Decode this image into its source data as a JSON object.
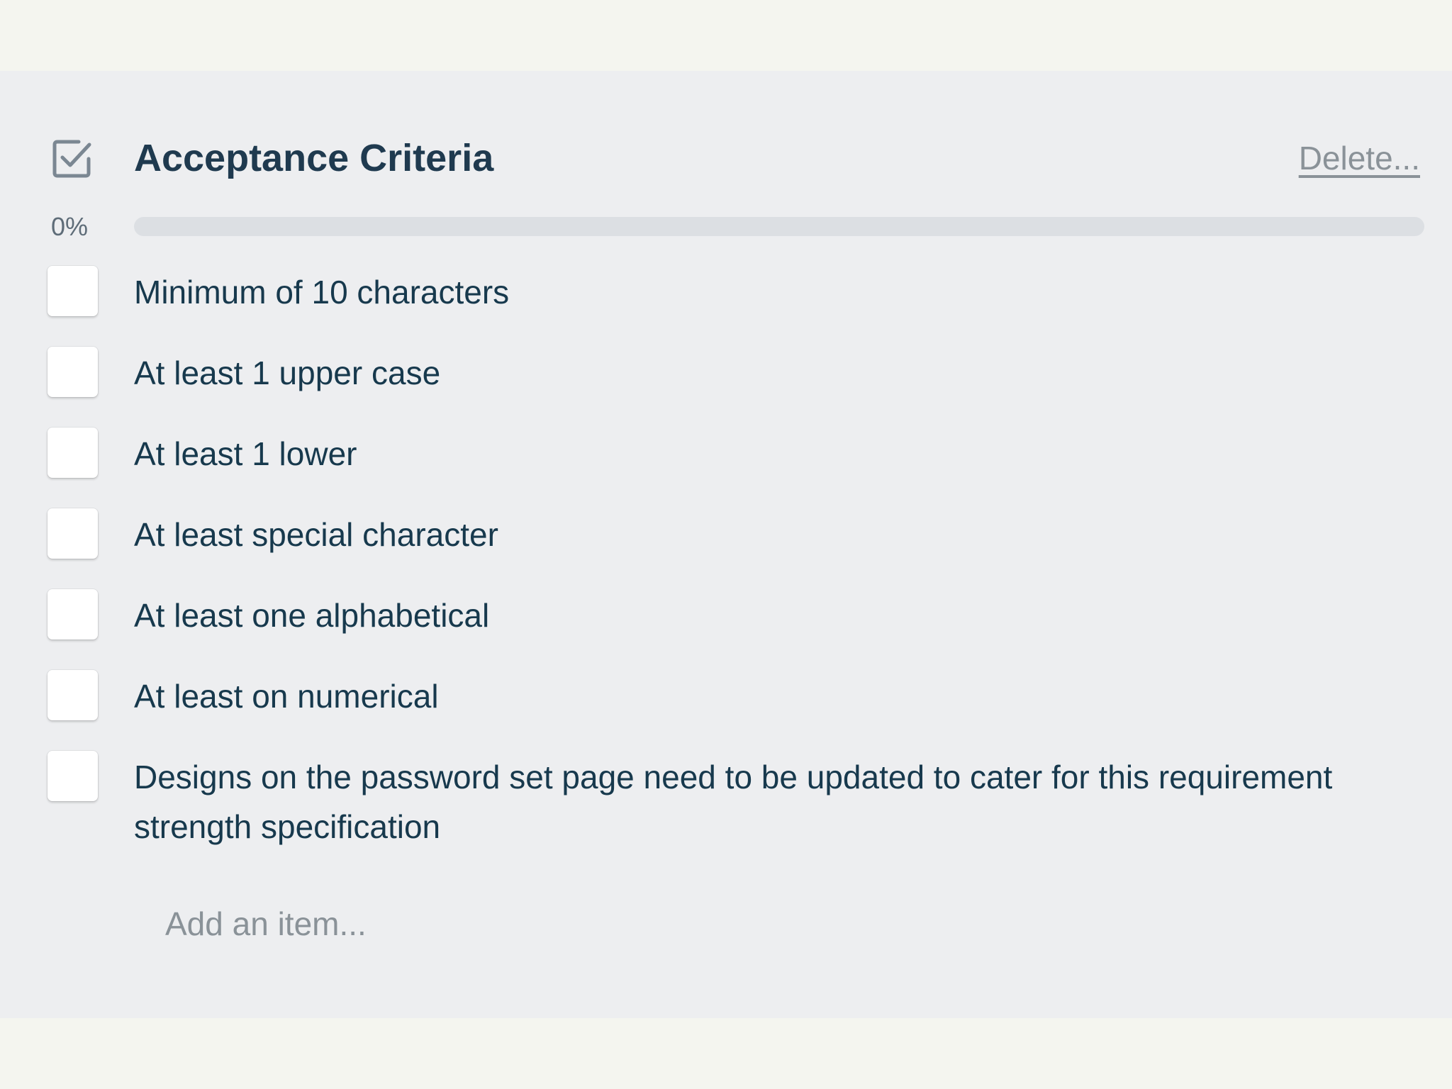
{
  "checklist": {
    "title": "Acceptance Criteria",
    "delete_label": "Delete...",
    "progress_label": "0%",
    "progress_fraction": 0,
    "add_item_placeholder": "Add an item...",
    "items": [
      {
        "text": "Minimum of 10 characters",
        "checked": false
      },
      {
        "text": "At least 1 upper case",
        "checked": false
      },
      {
        "text": "At least 1 lower",
        "checked": false
      },
      {
        "text": "At least special character",
        "checked": false
      },
      {
        "text": "At least one alphabetical",
        "checked": false
      },
      {
        "text": "At least on numerical",
        "checked": false
      },
      {
        "text": "Designs on the password set page need to be updated to cater for this requirement strength specification",
        "checked": false
      }
    ]
  },
  "colors": {
    "page_background": "#f4f5ef",
    "panel_background": "#edeef0",
    "title_text": "#1f3a4f",
    "muted_text": "#8a9298",
    "progress_track": "#dcdfe3"
  },
  "icons": {
    "header_icon": "checkbox-checked-icon"
  }
}
